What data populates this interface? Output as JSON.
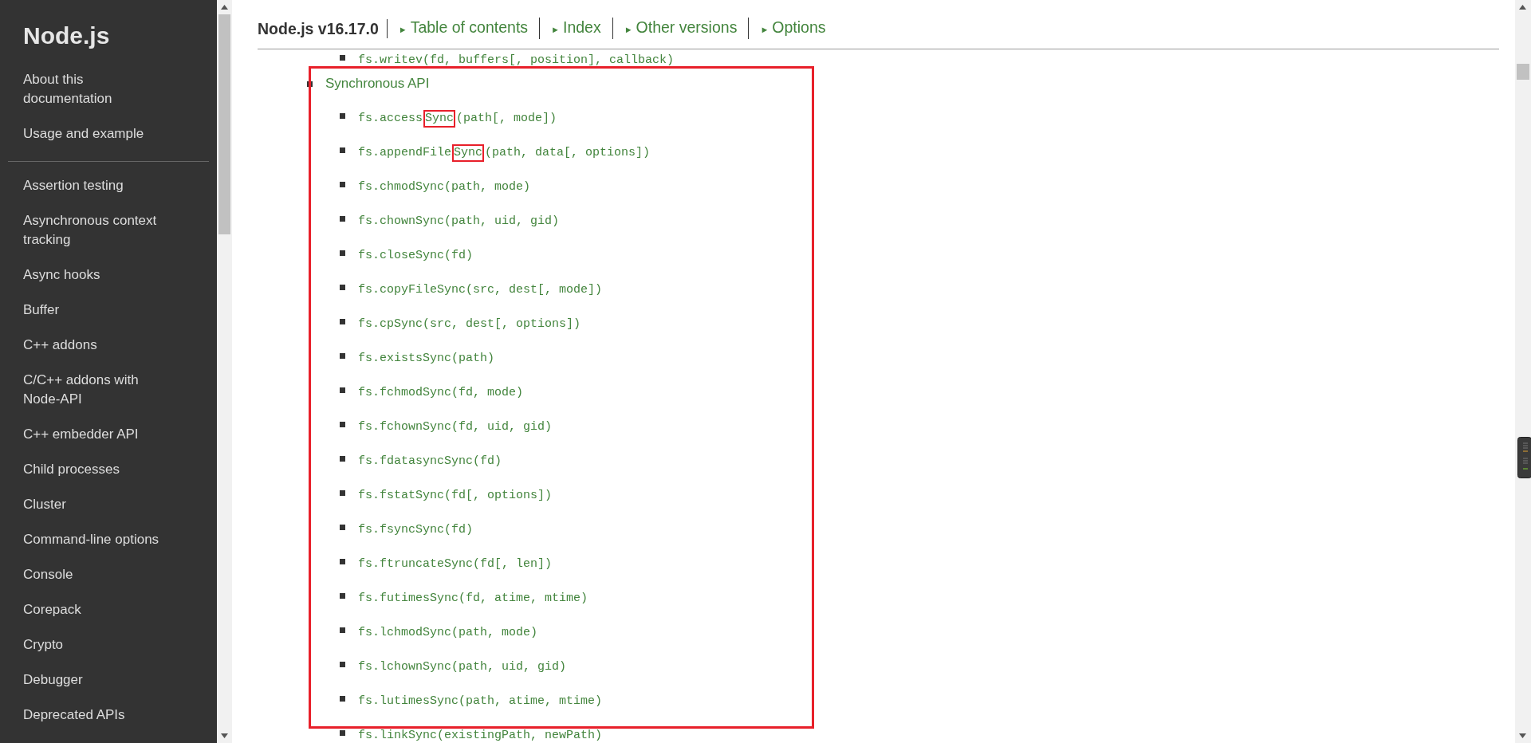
{
  "sidebar": {
    "title": "Node.js",
    "sections": [
      {
        "items": [
          "About this documentation",
          "Usage and example"
        ]
      },
      {
        "items": [
          "Assertion testing",
          "Asynchronous context tracking",
          "Async hooks",
          "Buffer",
          "C++ addons",
          "C/C++ addons with Node-API",
          "C++ embedder API",
          "Child processes",
          "Cluster",
          "Command-line options",
          "Console",
          "Corepack",
          "Crypto",
          "Debugger",
          "Deprecated APIs"
        ]
      }
    ]
  },
  "header": {
    "title": "Node.js v16.17.0",
    "links": [
      {
        "arrow": "►",
        "label": "Table of contents"
      },
      {
        "arrow": "►",
        "label": "Index"
      },
      {
        "arrow": "►",
        "label": "Other versions"
      },
      {
        "arrow": "►",
        "label": "Options"
      }
    ]
  },
  "content": {
    "sections": [
      {
        "children": [
          {
            "text": "fs.writev(fd, buffers[, position], callback)",
            "boxed": false
          }
        ]
      },
      {
        "label": "Synchronous API",
        "boxed": true,
        "children": [
          {
            "parts": [
              {
                "text": "fs.access",
                "boxed": false
              },
              {
                "text": "Sync",
                "boxed": true
              },
              {
                "text": "(path[, mode])",
                "boxed": false
              }
            ],
            "boxed": true
          },
          {
            "parts": [
              {
                "text": "fs.appendFile",
                "boxed": false
              },
              {
                "text": "Sync",
                "boxed": true
              },
              {
                "text": "(path, data[, options])",
                "boxed": false
              }
            ],
            "boxed": true
          },
          {
            "text": "fs.chmodSync(path, mode)",
            "boxed": true
          },
          {
            "text": "fs.chownSync(path, uid, gid)",
            "boxed": true
          },
          {
            "text": "fs.closeSync(fd)",
            "boxed": true
          },
          {
            "text": "fs.copyFileSync(src, dest[, mode])",
            "boxed": true
          },
          {
            "text": "fs.cpSync(src, dest[, options])",
            "boxed": true
          },
          {
            "text": "fs.existsSync(path)",
            "boxed": true
          },
          {
            "text": "fs.fchmodSync(fd, mode)",
            "boxed": true
          },
          {
            "text": "fs.fchownSync(fd, uid, gid)",
            "boxed": true
          },
          {
            "text": "fs.fdatasyncSync(fd)",
            "boxed": true
          },
          {
            "text": "fs.fstatSync(fd[, options])",
            "boxed": true
          },
          {
            "text": "fs.fsyncSync(fd)",
            "boxed": true
          },
          {
            "text": "fs.ftruncateSync(fd[, len])",
            "boxed": true
          },
          {
            "text": "fs.futimesSync(fd, atime, mtime)",
            "boxed": true
          },
          {
            "text": "fs.lchmodSync(path, mode)",
            "boxed": true
          },
          {
            "text": "fs.lchownSync(path, uid, gid)",
            "boxed": true
          },
          {
            "text": "fs.lutimesSync(path, atime, mtime)",
            "boxed": true
          },
          {
            "text": "fs.linkSync(existingPath, newPath)",
            "boxed": false
          }
        ]
      }
    ]
  }
}
